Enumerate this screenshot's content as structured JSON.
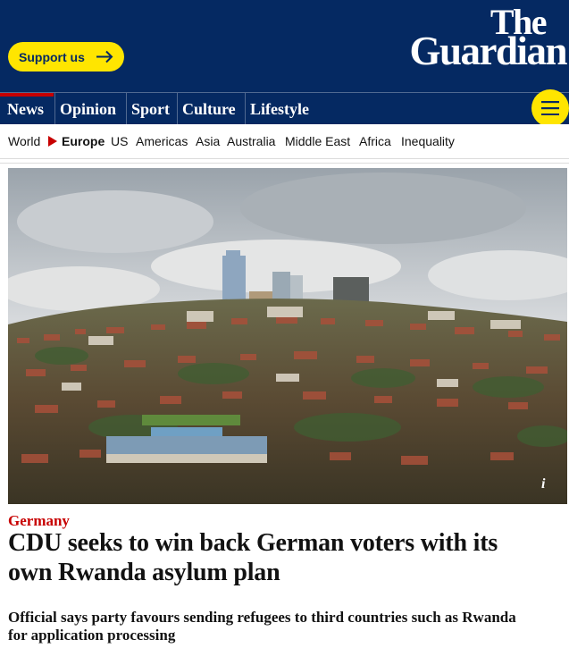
{
  "masthead": {
    "support_label": "Support us",
    "logo_line1": "The",
    "logo_line2": "Guardian",
    "brand_color": "#052962",
    "accent_color": "#ffe500"
  },
  "pillars": [
    {
      "label": "News",
      "active": true
    },
    {
      "label": "Opinion"
    },
    {
      "label": "Sport"
    },
    {
      "label": "Culture"
    },
    {
      "label": "Lifestyle"
    }
  ],
  "menu_icon": "hamburger-icon",
  "subnav": {
    "items": [
      "World",
      "Europe",
      "US",
      "Americas",
      "Asia",
      "Australia",
      "Middle East",
      "Africa",
      "Inequality"
    ],
    "active": "Europe"
  },
  "hero": {
    "info_icon": "info-icon",
    "info_glyph": "i"
  },
  "article": {
    "kicker": "Germany",
    "kicker_color": "#c70000",
    "headline": "CDU seeks to win back German voters with its own Rwanda asylum plan",
    "standfirst": "Official says party favours sending refugees to third countries such as Rwanda for application processing"
  }
}
